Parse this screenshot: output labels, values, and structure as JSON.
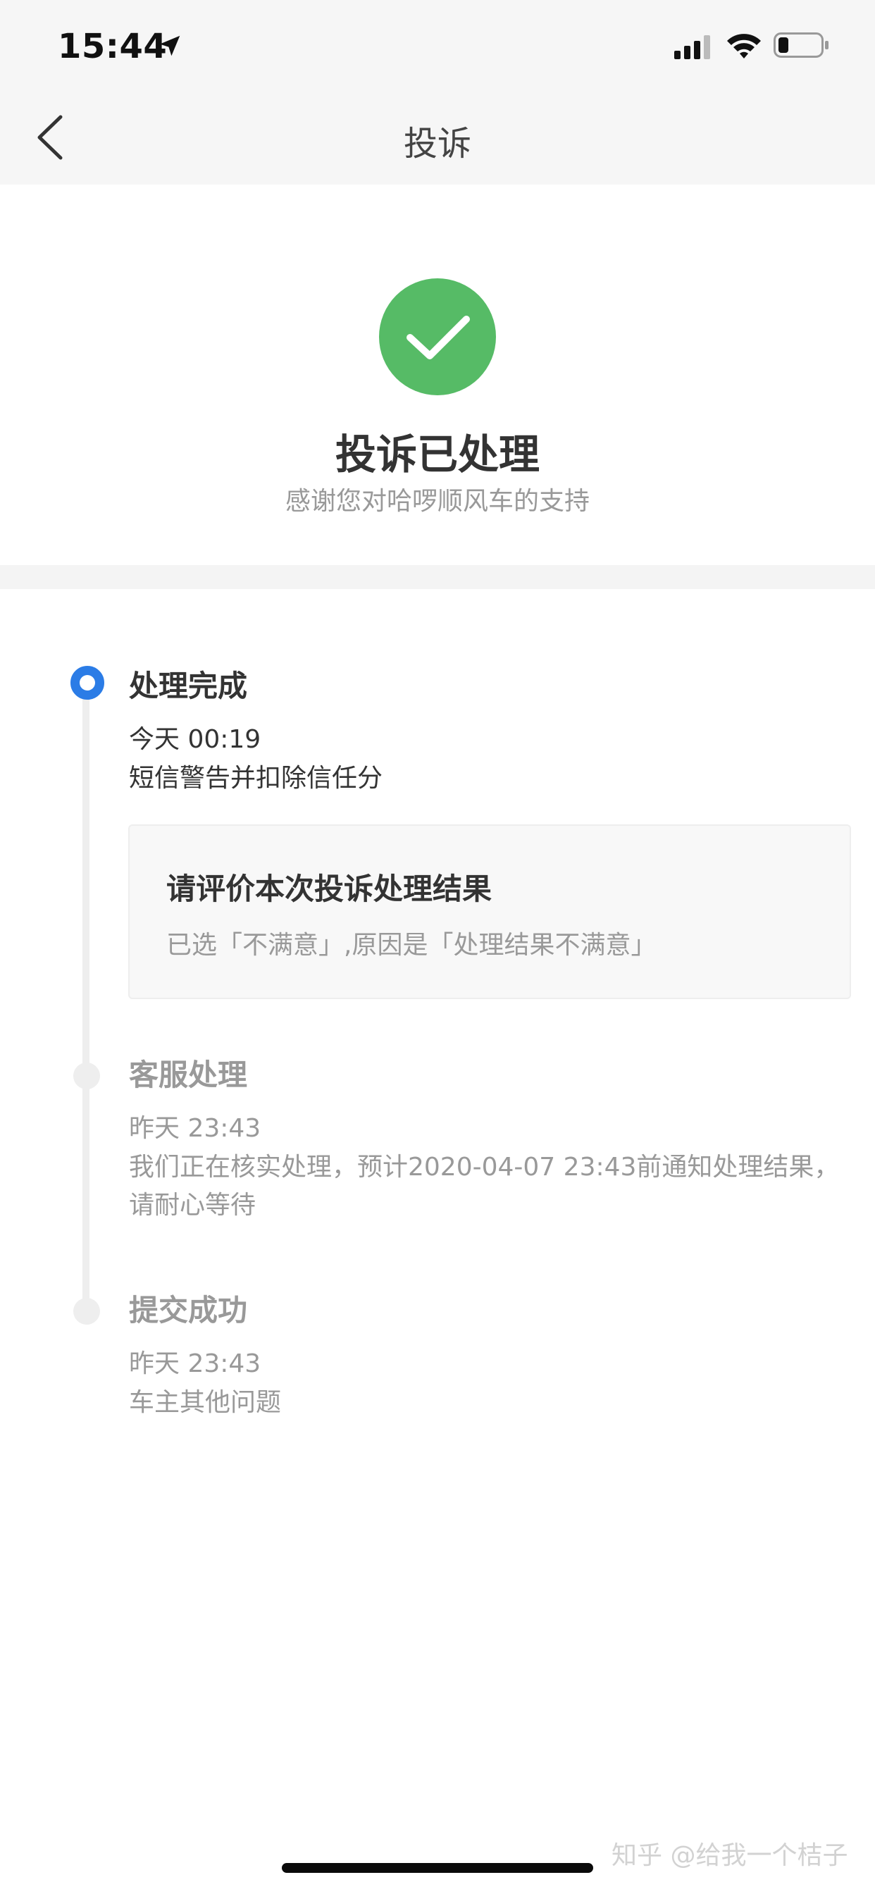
{
  "status_bar": {
    "time": "15:44"
  },
  "nav": {
    "title": "投诉"
  },
  "result": {
    "title": "投诉已处理",
    "subtitle": "感谢您对哈啰顺风车的支持",
    "icon": "check-circle-icon",
    "color": "#56bb66"
  },
  "timeline": {
    "active_color": "#2b7ce6",
    "steps": [
      {
        "title": "处理完成",
        "time": "今天 00:19",
        "desc": "短信警告并扣除信任分",
        "active": true
      },
      {
        "title": "客服处理",
        "time": "昨天 23:43",
        "desc": "我们正在核实处理，预计2020-04-07 23:43前通知处理结果，请耐心等待",
        "active": false
      },
      {
        "title": "提交成功",
        "time": "昨天 23:43",
        "desc": "车主其他问题",
        "active": false
      }
    ]
  },
  "evaluation": {
    "title": "请评价本次投诉处理结果",
    "desc": "已选「不满意」,原因是「处理结果不满意」"
  },
  "footer": {
    "watermark": "知乎 @给我一个桔子"
  }
}
